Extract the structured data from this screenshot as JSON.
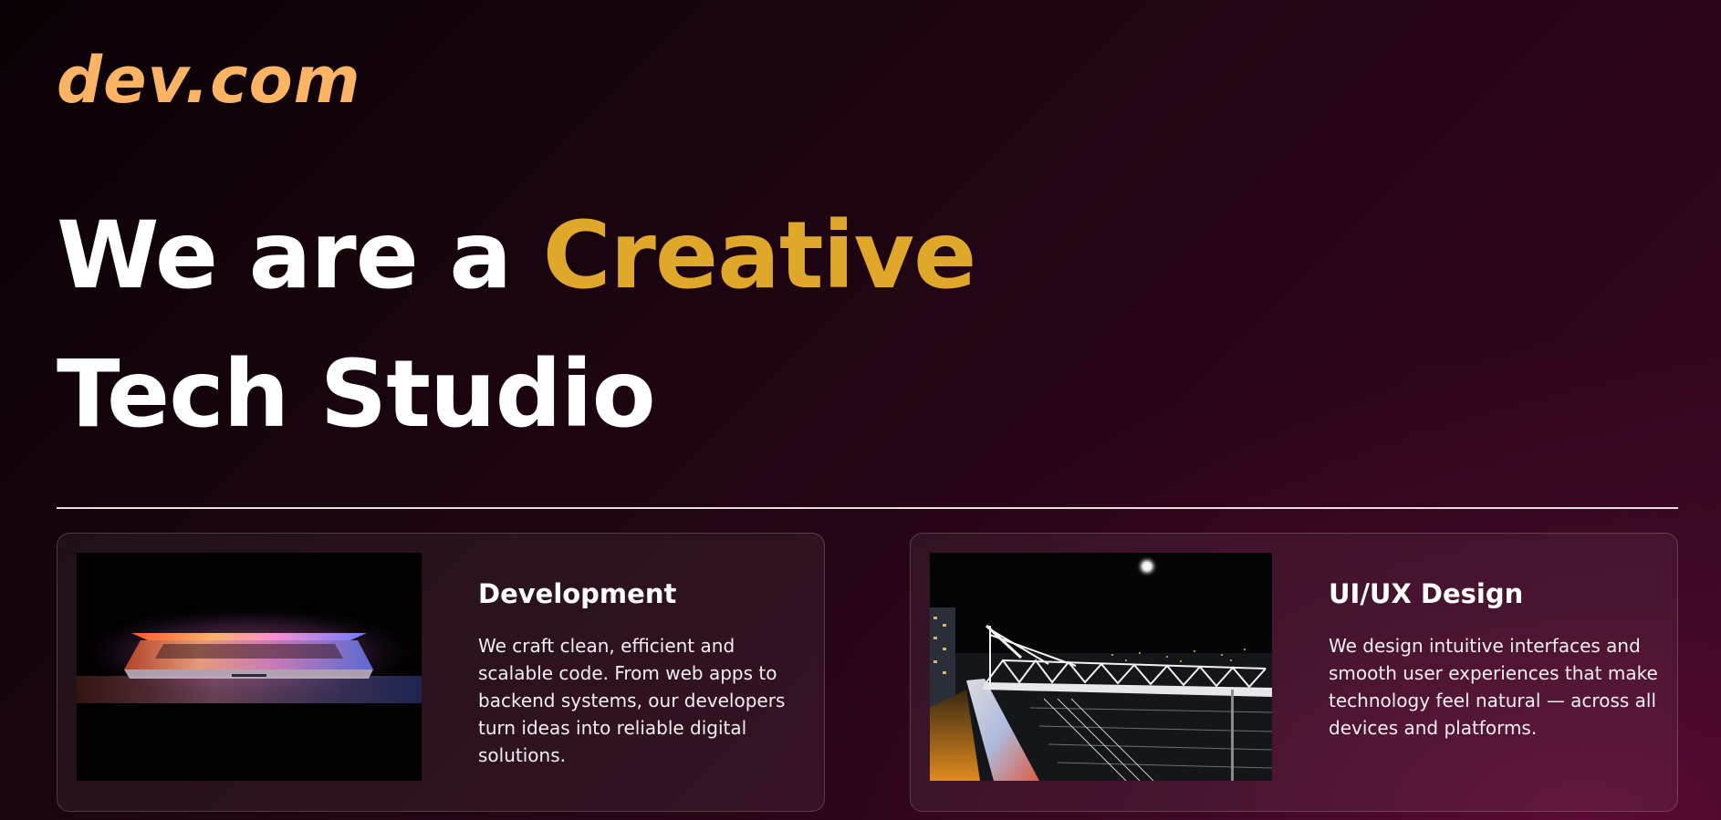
{
  "brand": {
    "logo_text": "dev.com",
    "logo_color": "#fbb464"
  },
  "hero": {
    "line1_prefix": "We are a ",
    "line1_accent": "Creative",
    "line2": "Tech Studio",
    "accent_color": "#e0a82a"
  },
  "services": [
    {
      "title": "Development",
      "description": "We craft clean, efficient and scalable code. From web apps to backend systems, our developers turn ideas into reliable digital solutions.",
      "image": "laptop-image"
    },
    {
      "title": "UI/UX Design",
      "description": "We design intuitive interfaces and smooth user experiences that make technology feel natural — across all devices and platforms.",
      "image": "night-bridge-image"
    }
  ]
}
